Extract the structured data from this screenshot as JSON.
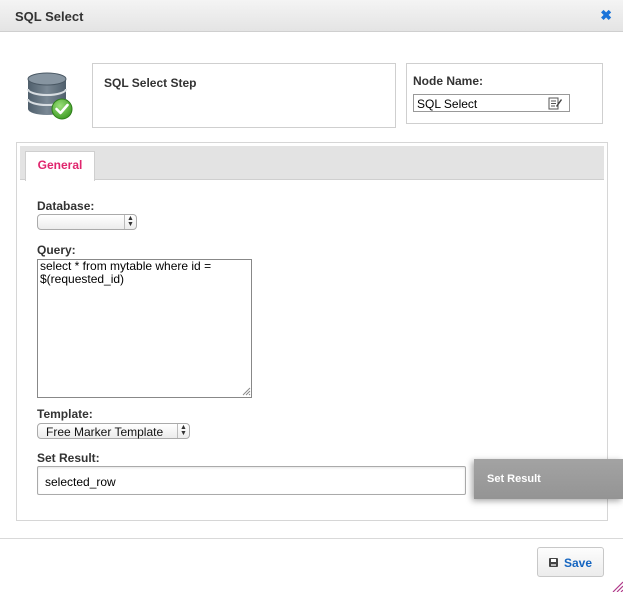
{
  "window": {
    "title": "SQL Select",
    "close_icon": "close-icon"
  },
  "header": {
    "icon": "database-check-icon",
    "step_label": "SQL Select Step",
    "node_name_label": "Node Name:",
    "node_name_value": "SQL Select",
    "edit_icon": "edit-icon"
  },
  "tabs": [
    {
      "label": "General",
      "active": true
    }
  ],
  "form": {
    "database_label": "Database:",
    "database_value": "",
    "query_label": "Query:",
    "query_value": "select * from mytable where id =\n$(requested_id)",
    "template_label": "Template:",
    "template_value": "Free Marker Template",
    "set_result_label": "Set Result:",
    "set_result_value": "selected_row",
    "set_result_button": "Set Result"
  },
  "footer": {
    "save_label": "Save",
    "save_icon": "floppy-disk-icon"
  },
  "colors": {
    "tab_active": "#e0266e",
    "link": "#1565c0",
    "close": "#1a73d9",
    "set_result_bg": "#9a9a9a",
    "check_green": "#4caf32"
  }
}
